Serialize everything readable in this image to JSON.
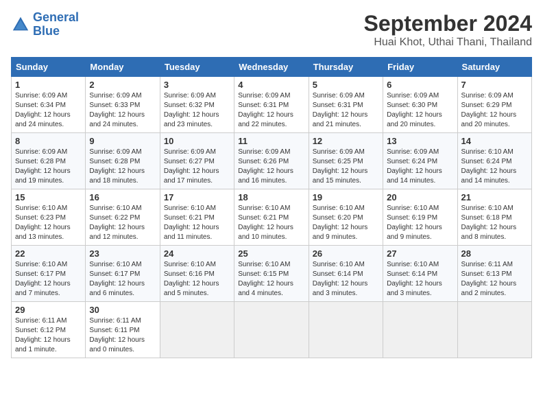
{
  "logo": {
    "line1": "General",
    "line2": "Blue"
  },
  "title": "September 2024",
  "subtitle": "Huai Khot, Uthai Thani, Thailand",
  "weekdays": [
    "Sunday",
    "Monday",
    "Tuesday",
    "Wednesday",
    "Thursday",
    "Friday",
    "Saturday"
  ],
  "weeks": [
    [
      {
        "day": "1",
        "info": "Sunrise: 6:09 AM\nSunset: 6:34 PM\nDaylight: 12 hours\nand 24 minutes."
      },
      {
        "day": "2",
        "info": "Sunrise: 6:09 AM\nSunset: 6:33 PM\nDaylight: 12 hours\nand 24 minutes."
      },
      {
        "day": "3",
        "info": "Sunrise: 6:09 AM\nSunset: 6:32 PM\nDaylight: 12 hours\nand 23 minutes."
      },
      {
        "day": "4",
        "info": "Sunrise: 6:09 AM\nSunset: 6:31 PM\nDaylight: 12 hours\nand 22 minutes."
      },
      {
        "day": "5",
        "info": "Sunrise: 6:09 AM\nSunset: 6:31 PM\nDaylight: 12 hours\nand 21 minutes."
      },
      {
        "day": "6",
        "info": "Sunrise: 6:09 AM\nSunset: 6:30 PM\nDaylight: 12 hours\nand 20 minutes."
      },
      {
        "day": "7",
        "info": "Sunrise: 6:09 AM\nSunset: 6:29 PM\nDaylight: 12 hours\nand 20 minutes."
      }
    ],
    [
      {
        "day": "8",
        "info": "Sunrise: 6:09 AM\nSunset: 6:28 PM\nDaylight: 12 hours\nand 19 minutes."
      },
      {
        "day": "9",
        "info": "Sunrise: 6:09 AM\nSunset: 6:28 PM\nDaylight: 12 hours\nand 18 minutes."
      },
      {
        "day": "10",
        "info": "Sunrise: 6:09 AM\nSunset: 6:27 PM\nDaylight: 12 hours\nand 17 minutes."
      },
      {
        "day": "11",
        "info": "Sunrise: 6:09 AM\nSunset: 6:26 PM\nDaylight: 12 hours\nand 16 minutes."
      },
      {
        "day": "12",
        "info": "Sunrise: 6:09 AM\nSunset: 6:25 PM\nDaylight: 12 hours\nand 15 minutes."
      },
      {
        "day": "13",
        "info": "Sunrise: 6:09 AM\nSunset: 6:24 PM\nDaylight: 12 hours\nand 14 minutes."
      },
      {
        "day": "14",
        "info": "Sunrise: 6:10 AM\nSunset: 6:24 PM\nDaylight: 12 hours\nand 14 minutes."
      }
    ],
    [
      {
        "day": "15",
        "info": "Sunrise: 6:10 AM\nSunset: 6:23 PM\nDaylight: 12 hours\nand 13 minutes."
      },
      {
        "day": "16",
        "info": "Sunrise: 6:10 AM\nSunset: 6:22 PM\nDaylight: 12 hours\nand 12 minutes."
      },
      {
        "day": "17",
        "info": "Sunrise: 6:10 AM\nSunset: 6:21 PM\nDaylight: 12 hours\nand 11 minutes."
      },
      {
        "day": "18",
        "info": "Sunrise: 6:10 AM\nSunset: 6:21 PM\nDaylight: 12 hours\nand 10 minutes."
      },
      {
        "day": "19",
        "info": "Sunrise: 6:10 AM\nSunset: 6:20 PM\nDaylight: 12 hours\nand 9 minutes."
      },
      {
        "day": "20",
        "info": "Sunrise: 6:10 AM\nSunset: 6:19 PM\nDaylight: 12 hours\nand 9 minutes."
      },
      {
        "day": "21",
        "info": "Sunrise: 6:10 AM\nSunset: 6:18 PM\nDaylight: 12 hours\nand 8 minutes."
      }
    ],
    [
      {
        "day": "22",
        "info": "Sunrise: 6:10 AM\nSunset: 6:17 PM\nDaylight: 12 hours\nand 7 minutes."
      },
      {
        "day": "23",
        "info": "Sunrise: 6:10 AM\nSunset: 6:17 PM\nDaylight: 12 hours\nand 6 minutes."
      },
      {
        "day": "24",
        "info": "Sunrise: 6:10 AM\nSunset: 6:16 PM\nDaylight: 12 hours\nand 5 minutes."
      },
      {
        "day": "25",
        "info": "Sunrise: 6:10 AM\nSunset: 6:15 PM\nDaylight: 12 hours\nand 4 minutes."
      },
      {
        "day": "26",
        "info": "Sunrise: 6:10 AM\nSunset: 6:14 PM\nDaylight: 12 hours\nand 3 minutes."
      },
      {
        "day": "27",
        "info": "Sunrise: 6:10 AM\nSunset: 6:14 PM\nDaylight: 12 hours\nand 3 minutes."
      },
      {
        "day": "28",
        "info": "Sunrise: 6:11 AM\nSunset: 6:13 PM\nDaylight: 12 hours\nand 2 minutes."
      }
    ],
    [
      {
        "day": "29",
        "info": "Sunrise: 6:11 AM\nSunset: 6:12 PM\nDaylight: 12 hours\nand 1 minute."
      },
      {
        "day": "30",
        "info": "Sunrise: 6:11 AM\nSunset: 6:11 PM\nDaylight: 12 hours\nand 0 minutes."
      },
      {
        "day": "",
        "info": ""
      },
      {
        "day": "",
        "info": ""
      },
      {
        "day": "",
        "info": ""
      },
      {
        "day": "",
        "info": ""
      },
      {
        "day": "",
        "info": ""
      }
    ]
  ]
}
